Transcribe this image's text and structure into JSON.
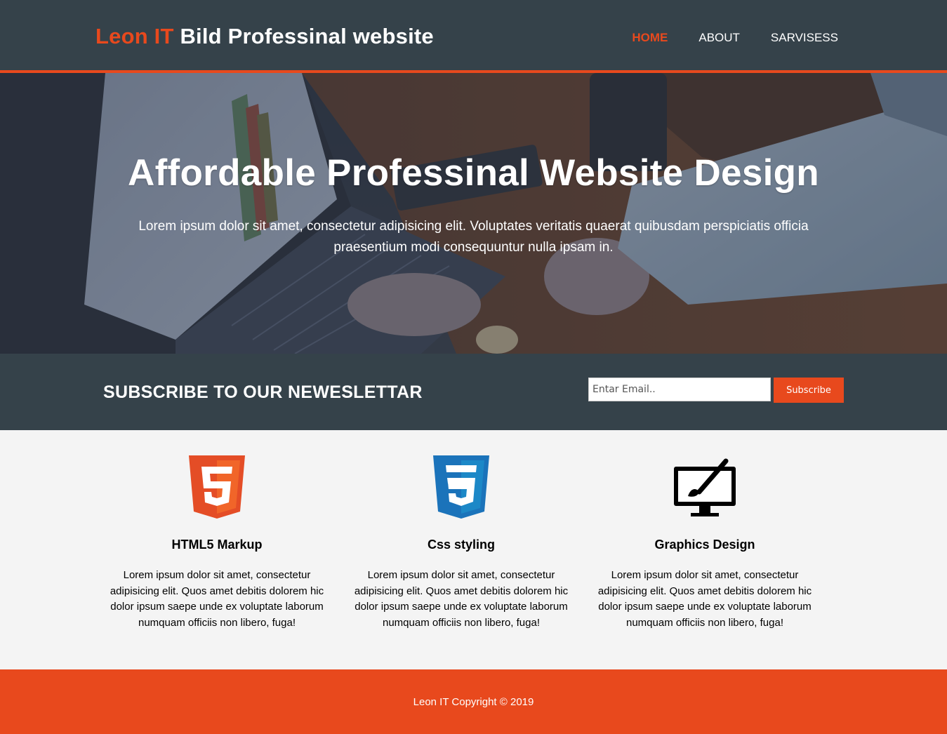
{
  "header": {
    "brand_accent": "Leon IT",
    "brand_rest": " Bild Professinal website",
    "nav": [
      {
        "label": "HOME",
        "active": true
      },
      {
        "label": "ABOUT",
        "active": false
      },
      {
        "label": "SARVISESS",
        "active": false
      }
    ]
  },
  "hero": {
    "title": "Affordable Professinal Website Design",
    "text": "Lorem ipsum dolor sit amet, consectetur adipisicing elit. Voluptates veritatis quaerat quibusdam perspiciatis officia praesentium modi consequuntur nulla ipsam in."
  },
  "newsletter": {
    "title": "SUBSCRIBE TO OUR NEWESLETTAR",
    "input_placeholder": "Entar Email..",
    "button_label": "Subscribe"
  },
  "boxes": [
    {
      "icon": "html5-icon",
      "title": "HTML5 Markup",
      "text": "Lorem ipsum dolor sit amet, consectetur adipisicing elit. Quos amet debitis dolorem hic dolor ipsum saepe unde ex voluptate laborum numquam officiis non libero, fuga!"
    },
    {
      "icon": "css3-icon",
      "title": "Css styling",
      "text": "Lorem ipsum dolor sit amet, consectetur adipisicing elit. Quos amet debitis dolorem hic dolor ipsum saepe unde ex voluptate laborum numquam officiis non libero, fuga!"
    },
    {
      "icon": "graphics-design-icon",
      "title": "Graphics Design",
      "text": "Lorem ipsum dolor sit amet, consectetur adipisicing elit. Quos amet debitis dolorem hic dolor ipsum saepe unde ex voluptate laborum numquam officiis non libero, fuga!"
    }
  ],
  "footer": {
    "text": "Leon IT Copyright © 2019"
  },
  "colors": {
    "dark": "#35424a",
    "accent": "#e8491d",
    "light_bg": "#f4f4f4"
  }
}
